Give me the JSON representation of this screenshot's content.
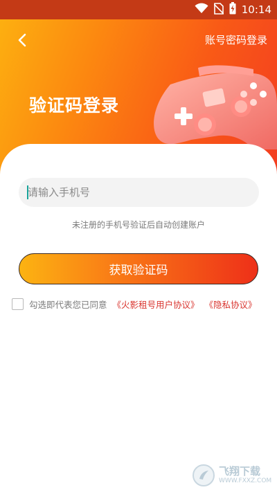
{
  "status_bar": {
    "time": "10:14"
  },
  "header": {
    "switch_label": "账号密码登录",
    "title": "验证码登录"
  },
  "form": {
    "phone_placeholder": "请输入手机号",
    "phone_value": "",
    "hint": "未注册的手机号验证后自动创建账户",
    "submit_label": "获取验证码"
  },
  "agreement": {
    "checked": false,
    "text": "勾选即代表您已同意",
    "user_agreement": "《火影租号用户协议》",
    "privacy_policy": "《隐私协议》"
  },
  "watermark": {
    "title": "飞翔下载",
    "url": "WWW.FXXZ.COM"
  },
  "colors": {
    "gradient_start": "#fdb210",
    "gradient_end": "#f23a22",
    "link": "#d9352f",
    "status_bar": "#c43a16"
  },
  "icons": [
    "wifi-icon",
    "no-sim-icon",
    "battery-charging-icon",
    "back-arrow-icon",
    "gamepad-icon",
    "watermark-logo-icon"
  ]
}
